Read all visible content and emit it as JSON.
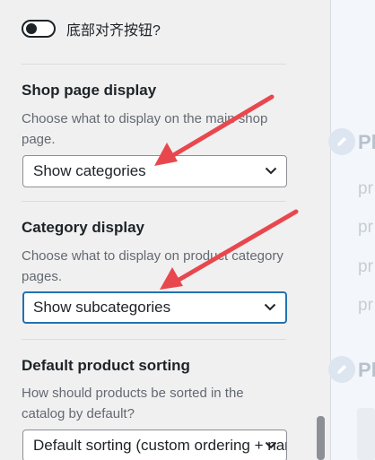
{
  "toggle": {
    "label": "底部对齐按钮?",
    "checked": false
  },
  "shop_page_display": {
    "title": "Shop page display",
    "description": "Choose what to display on the main shop page.",
    "selected": "Show categories"
  },
  "category_display": {
    "title": "Category display",
    "description": "Choose what to display on product category pages.",
    "selected": "Show subcategories"
  },
  "default_sorting": {
    "title": "Default product sorting",
    "description": "How should products be sorted in the catalog by default?",
    "selected": "Default sorting (custom ordering + name)"
  },
  "preview": {
    "heading_1": "Pl",
    "heading_2": "Pl",
    "lines": [
      "pr",
      "pr",
      "pr",
      "pr"
    ]
  },
  "colors": {
    "accent": "#2271b1",
    "annotation_arrow": "#e8484d"
  }
}
